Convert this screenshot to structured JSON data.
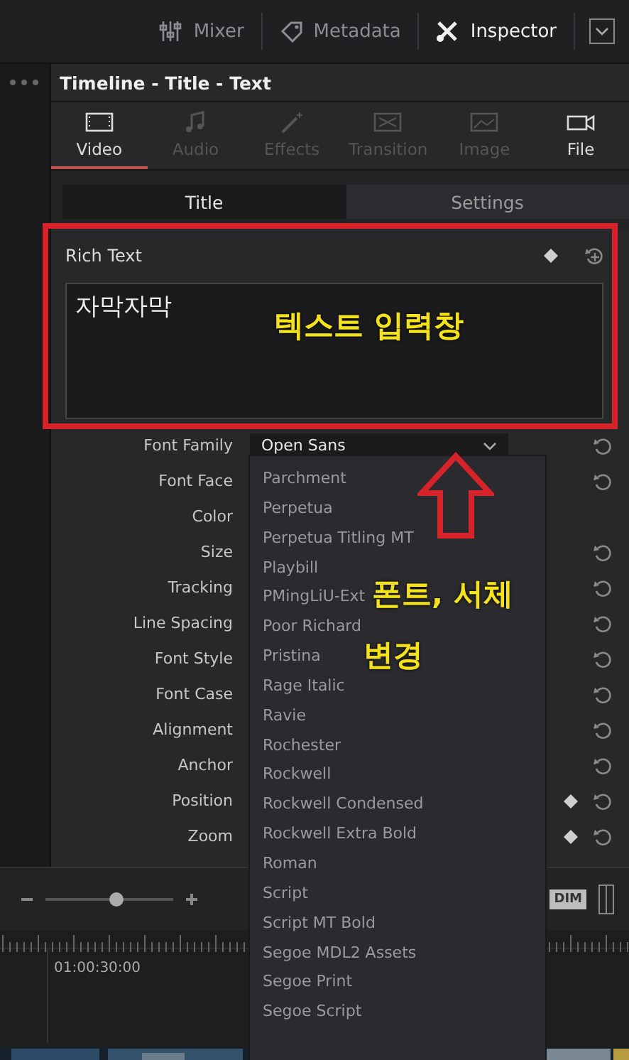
{
  "topbar": {
    "items": [
      {
        "label": "Mixer",
        "selected": false
      },
      {
        "label": "Metadata",
        "selected": false
      },
      {
        "label": "Inspector",
        "selected": true
      }
    ]
  },
  "inspector": {
    "title": "Timeline - Title - Text",
    "tabs": [
      {
        "label": "Video",
        "selected": true,
        "disabled": false
      },
      {
        "label": "Audio",
        "selected": false,
        "disabled": true
      },
      {
        "label": "Effects",
        "selected": false,
        "disabled": true
      },
      {
        "label": "Transition",
        "selected": false,
        "disabled": true
      },
      {
        "label": "Image",
        "selected": false,
        "disabled": true
      },
      {
        "label": "File",
        "selected": false,
        "disabled": false
      }
    ],
    "subtabs": [
      {
        "label": "Title",
        "selected": true
      },
      {
        "label": "Settings",
        "selected": false
      }
    ],
    "rich_text": {
      "label": "Rich Text",
      "value": "자막자막"
    },
    "rows": [
      {
        "label": "Font Family",
        "kind": "dropdown",
        "value": "Open Sans",
        "reset": true,
        "keyframe": false
      },
      {
        "label": "Font Face",
        "kind": "plain",
        "reset": true,
        "keyframe": false
      },
      {
        "label": "Color",
        "kind": "plain",
        "reset": false,
        "keyframe": false
      },
      {
        "label": "Size",
        "kind": "plain",
        "reset": true,
        "keyframe": false
      },
      {
        "label": "Tracking",
        "kind": "plain",
        "reset": true,
        "keyframe": false
      },
      {
        "label": "Line Spacing",
        "kind": "plain",
        "reset": true,
        "keyframe": false
      },
      {
        "label": "Font Style",
        "kind": "plain",
        "reset": true,
        "keyframe": false
      },
      {
        "label": "Font Case",
        "kind": "plain",
        "reset": true,
        "keyframe": false
      },
      {
        "label": "Alignment",
        "kind": "plain",
        "reset": true,
        "keyframe": false
      },
      {
        "label": "Anchor",
        "kind": "plain",
        "reset": true,
        "keyframe": false
      },
      {
        "label": "Position",
        "kind": "plain",
        "reset": true,
        "keyframe": true
      },
      {
        "label": "Zoom",
        "kind": "plain",
        "reset": true,
        "keyframe": true
      }
    ]
  },
  "font_dropdown": {
    "items": [
      "Parchment",
      "Perpetua",
      "Perpetua Titling MT",
      "Playbill",
      "PMingLiU-Ext",
      "Poor Richard",
      "Pristina",
      "Rage Italic",
      "Ravie",
      "Rochester",
      "Rockwell",
      "Rockwell Condensed",
      "Rockwell Extra Bold",
      "Roman",
      "Script",
      "Script MT Bold",
      "Segoe MDL2 Assets",
      "Segoe Print",
      "Segoe Script"
    ]
  },
  "timeline": {
    "zoom": {
      "level": 0.55
    },
    "dim_button": "DIM",
    "timecode": "01:00:30:00"
  },
  "annotations": [
    {
      "kind": "box"
    },
    {
      "kind": "text",
      "text": "텍스트 입력창"
    },
    {
      "kind": "arrow"
    },
    {
      "kind": "text",
      "text": "폰트, 서체"
    },
    {
      "kind": "text",
      "text": "변경"
    }
  ]
}
